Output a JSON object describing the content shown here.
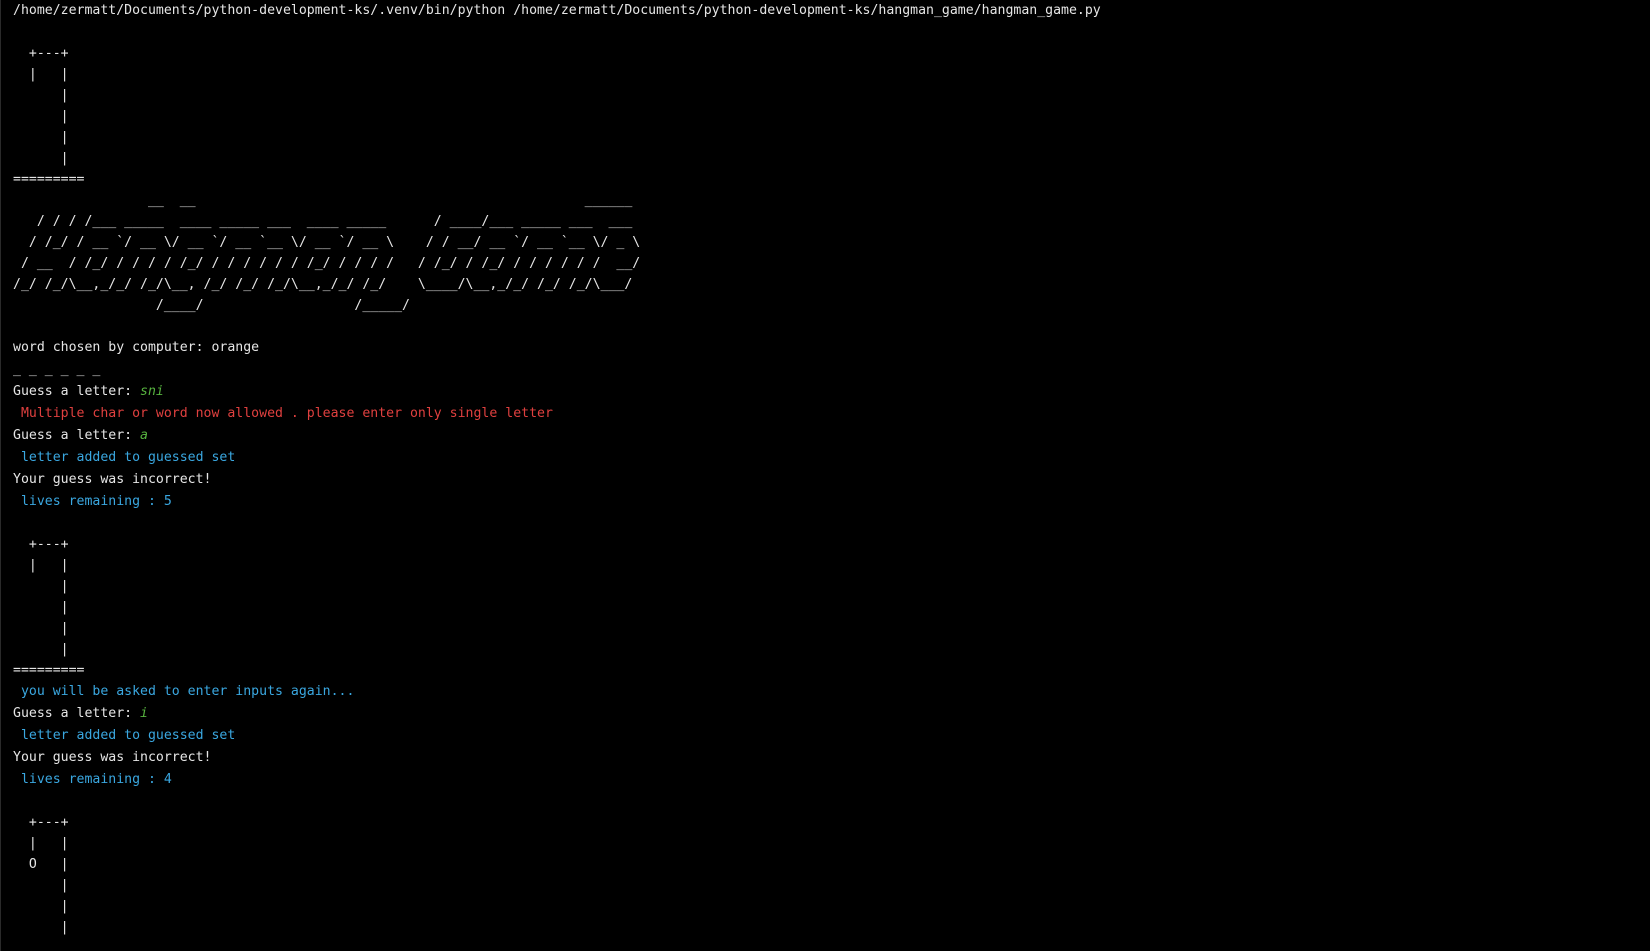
{
  "command": "/home/zermatt/Documents/python-development-ks/.venv/bin/python /home/zermatt/Documents/python-development-ks/hangman_game/hangman_game.py",
  "stage0": [
    "  +---+",
    "  |   |",
    "      |",
    "      |",
    "      |",
    "      |",
    "========="
  ],
  "banner": [
    "                 __  __                                                 ______",
    "   / / / /___ _____  ____ _____ ___  ____ _____      / ____/___ _____ ___  ___",
    "  / /_/ / __ `/ __ \\/ __ `/ __ `__ \\/ __ `/ __ \\    / / __/ __ `/ __ `__ \\/ _ \\",
    " / __  / /_/ / / / / /_/ / / / / / / /_/ / / / /   / /_/ / /_/ / / / / / /  __/",
    "/_/ /_/\\__,_/_/ /_/\\__, /_/ /_/ /_/\\__,_/_/ /_/    \\____/\\__,_/_/ /_/ /_/\\___/",
    "                  /____/                   /_____/"
  ],
  "word_chosen": "word chosen by computer: orange",
  "blanks": "_ _ _ _ _ _",
  "prompt": "Guess a letter: ",
  "guess1_input": "sni",
  "error1": " Multiple char or word now allowed . please enter only single letter",
  "guess2_input": "a",
  "added1": " letter added to guessed set",
  "incorrect1": "Your guess was incorrect!",
  "lives1": " lives remaining : 5",
  "stage1": [
    "  +---+",
    "  |   |",
    "      |",
    "      |",
    "      |",
    "      |",
    "========="
  ],
  "asked_again": " you will be asked to enter inputs again...",
  "guess3_input": "i",
  "added2": " letter added to guessed set",
  "incorrect2": "Your guess was incorrect!",
  "lives2": " lives remaining : 4",
  "stage2": [
    "  +---+",
    "  |   |",
    "  O   |",
    "      |",
    "      |",
    "      |"
  ],
  "colors": {
    "background": "#000000",
    "text": "#e6e6e6",
    "input": "#57b33f",
    "error": "#e0403f",
    "info": "#3aa7e0"
  }
}
